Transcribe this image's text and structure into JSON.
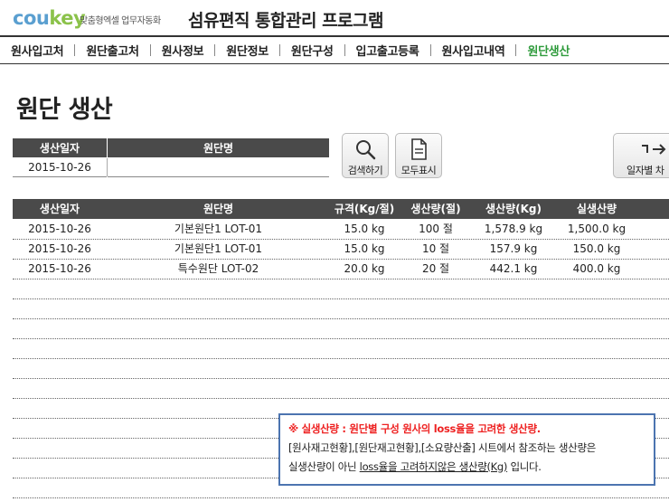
{
  "brand": {
    "logo_part1": "cou",
    "logo_part2": "key",
    "tagline": "맞춤형엑셀 업무자동화"
  },
  "app_title": "섬유편직 통합관리 프로그램",
  "nav": [
    {
      "label": "원사입고처",
      "active": false
    },
    {
      "label": "원단출고처",
      "active": false
    },
    {
      "label": "원사정보",
      "active": false
    },
    {
      "label": "원단정보",
      "active": false
    },
    {
      "label": "원단구성",
      "active": false
    },
    {
      "label": "입고출고등록",
      "active": false
    },
    {
      "label": "원사입고내역",
      "active": false
    },
    {
      "label": "원단생산",
      "active": true
    }
  ],
  "page_title": "원단 생산",
  "search": {
    "headers": [
      "생산일자",
      "원단명"
    ],
    "values": [
      "2015-10-26",
      ""
    ]
  },
  "buttons": {
    "search": {
      "label": "검색하기",
      "icon": "magnifier-icon"
    },
    "show_all": {
      "label": "모두표시",
      "icon": "document-icon"
    },
    "by_date": {
      "label": "일자별 차",
      "icon": "arrow-icon"
    }
  },
  "table": {
    "headers": [
      "생산일자",
      "원단명",
      "규격(Kg/절)",
      "생산량(절)",
      "생산량(Kg)",
      "실생산량"
    ],
    "rows": [
      [
        "2015-10-26",
        "기본원단1 LOT-01",
        "15.0 kg",
        "100 절",
        "1,578.9 kg",
        "1,500.0 kg"
      ],
      [
        "2015-10-26",
        "기본원단1 LOT-01",
        "15.0 kg",
        "10 절",
        "157.9 kg",
        "150.0 kg"
      ],
      [
        "2015-10-26",
        "특수원단 LOT-02",
        "20.0 kg",
        "20 절",
        "442.1 kg",
        "400.0 kg"
      ]
    ]
  },
  "note": {
    "line1": "※ 실생산량 : 원단별 구성 원사의 loss율을 고려한 생산량.",
    "line2": "[원사재고현황],[원단재고현황],[소요량산출] 시트에서 참조하는 생산량은",
    "line3_prefix": "실생산량이 아닌 ",
    "line3_underlined": "loss율을 고려하지않은 생산량(Kg)",
    "line3_suffix": " 입니다."
  },
  "colors": {
    "accent_green": "#2f9b3c",
    "header_dark": "#4a4a4a",
    "note_border": "#4c74b0",
    "note_red": "#ee2222"
  }
}
